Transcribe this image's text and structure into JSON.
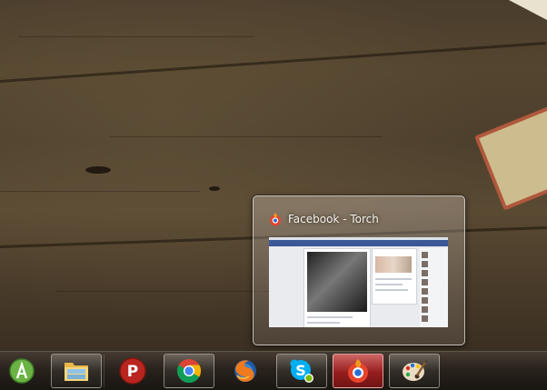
{
  "thumbnail": {
    "title": "Facebook - Torch",
    "app_icon": "torch-icon"
  },
  "taskbar": {
    "items": [
      {
        "name": "android-studio",
        "icon": "android-studio-icon",
        "running": false
      },
      {
        "name": "windows-explorer",
        "icon": "folder-icon",
        "running": true
      },
      {
        "name": "psiphon",
        "icon": "psiphon-p-icon",
        "running": false
      },
      {
        "name": "chrome",
        "icon": "chrome-icon",
        "running": true
      },
      {
        "name": "firefox",
        "icon": "firefox-icon",
        "running": false
      },
      {
        "name": "skype",
        "icon": "skype-icon",
        "running": true
      },
      {
        "name": "torch",
        "icon": "torch-icon",
        "running": true,
        "active": true
      },
      {
        "name": "paint",
        "icon": "paint-palette-icon",
        "running": true
      }
    ]
  },
  "colors": {
    "active_highlight": "#b02020",
    "facebook_blue": "#3b5998"
  }
}
